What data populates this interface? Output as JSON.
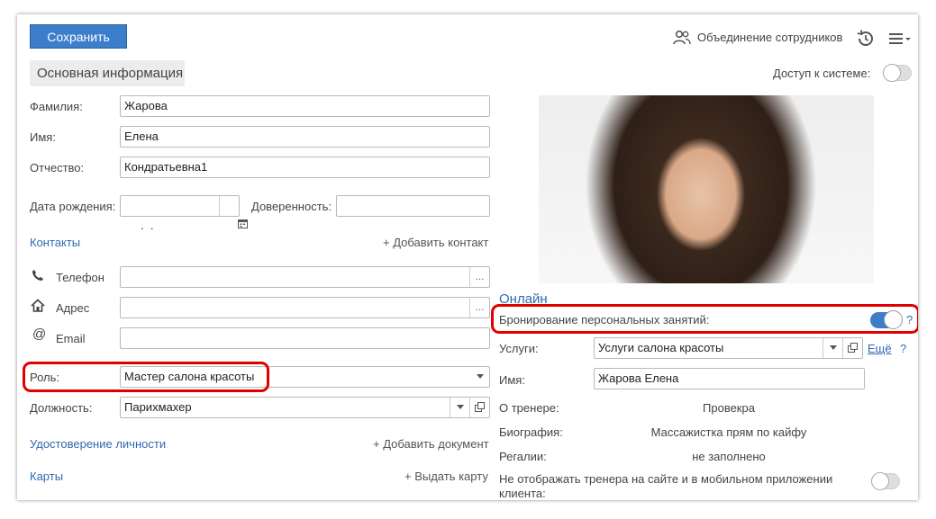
{
  "toolbar": {
    "save_label": "Сохранить",
    "merge_label": "Объединение сотрудников"
  },
  "tab_basic": "Основная информация",
  "access_label": "Доступ к системе:",
  "left": {
    "surname_label": "Фамилия:",
    "surname_value": "Жарова",
    "name_label": "Имя:",
    "name_value": "Елена",
    "patronymic_label": "Отчество:",
    "patronymic_value": "Кондратьевна1",
    "birth_label": "Дата рождения:",
    "birth_value": " .  .",
    "trust_label": "Доверенность:",
    "contacts_label": "Контакты",
    "add_contact": "+ Добавить контакт",
    "phone_label": "Телефон",
    "address_label": "Адрес",
    "email_label": "Email",
    "more_btn": "...",
    "role_label": "Роль:",
    "role_value": "Мастер салона красоты",
    "position_label": "Должность:",
    "position_value": "Парихмахер",
    "id_label": "Удостоверение личности",
    "add_document": "+ Добавить документ",
    "cards_label": "Карты",
    "issue_card": "+ Выдать карту"
  },
  "right": {
    "online_label": "Онлайн",
    "booking_label": "Бронирование персональных занятий:",
    "help": "?",
    "services_label": "Услуги:",
    "services_value": "Услуги салона красоты",
    "more_link": "Ещё",
    "name_label": "Имя:",
    "name_value": "Жарова Елена",
    "about_label": "О тренере:",
    "about_value": "Провекра",
    "bio_label": "Биография:",
    "bio_value": "Массажистка прям по кайфу",
    "regalia_label": "Регалии:",
    "regalia_value": "не заполнено",
    "hide_label_1": "Не отображать тренера на сайте и в мобильном приложении",
    "hide_label_2": "клиента:"
  },
  "colors": {
    "accent": "#3d7ecb",
    "link": "#3369b0",
    "highlight": "#e00000"
  },
  "icons": [
    "people-icon",
    "history-icon",
    "menu-icon",
    "calendar-icon",
    "phone-icon",
    "home-icon",
    "at-icon",
    "dropdown-icon",
    "open-form-icon"
  ]
}
